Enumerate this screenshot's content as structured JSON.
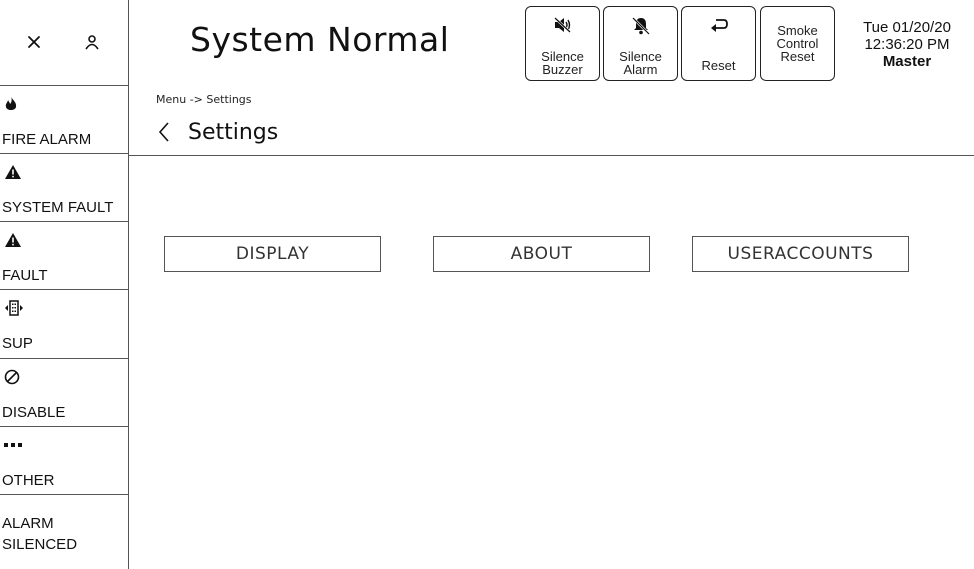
{
  "header": {
    "status_title": "System Normal",
    "buttons": {
      "silence_buzzer": "Silence\nBuzzer",
      "silence_alarm": "Silence\nAlarm",
      "reset": "Reset",
      "smoke_control_reset": "Smoke\nControl\nReset"
    },
    "datetime": {
      "date": "Tue 01/20/20",
      "time": "12:36:20 PM",
      "role": "Master"
    }
  },
  "sidebar": {
    "items": [
      {
        "label": "FIRE ALARM",
        "icon": "flame-icon"
      },
      {
        "label": "SYSTEM FAULT",
        "icon": "warning-icon"
      },
      {
        "label": "FAULT",
        "icon": "warning-icon"
      },
      {
        "label": "SUP",
        "icon": "supervisory-icon"
      },
      {
        "label": "DISABLE",
        "icon": "disable-icon"
      },
      {
        "label": "OTHER",
        "icon": "more-icon"
      },
      {
        "label": "ALARM\nSILENCED"
      }
    ]
  },
  "main": {
    "breadcrumb": "Menu  -> Settings",
    "title": "Settings",
    "options": [
      "DISPLAY",
      "ABOUT",
      "USERACCOUNTS"
    ]
  },
  "colors": {
    "border": "#555555",
    "text": "#111111",
    "background": "#ffffff"
  }
}
